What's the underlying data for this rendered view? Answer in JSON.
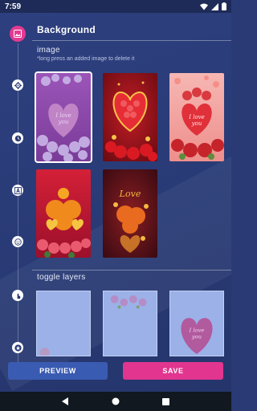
{
  "status_bar": {
    "time": "7:59",
    "icons": [
      "wifi-icon",
      "signal-icon",
      "battery-icon"
    ]
  },
  "header": {
    "title": "Background",
    "icon": "image-icon"
  },
  "image_section": {
    "label": "image",
    "hint": "*long press an added image to delete it",
    "thumbnails": [
      {
        "name": "purple-roses-heart",
        "selected": true
      },
      {
        "name": "red-gem-heart",
        "selected": false
      },
      {
        "name": "pink-roses-heart",
        "selected": false
      },
      {
        "name": "orange-roses-hearts",
        "selected": false
      },
      {
        "name": "love-rose-hearts",
        "selected": false
      }
    ]
  },
  "side_icons": [
    "settings-icon",
    "clock-icon",
    "text-icon",
    "smiley-icon",
    "touch-icon",
    "star-icon"
  ],
  "layers_section": {
    "label": "toggle layers",
    "layers": [
      "background-layer",
      "roses-layer",
      "heart-layer"
    ]
  },
  "buttons": {
    "preview": "PREVIEW",
    "save": "SAVE"
  },
  "colors": {
    "accent": "#e1358f",
    "primary_button": "#3a5bb2",
    "background": "#2a3a74"
  },
  "nav_bar": [
    "back-icon",
    "home-icon",
    "recents-icon"
  ]
}
